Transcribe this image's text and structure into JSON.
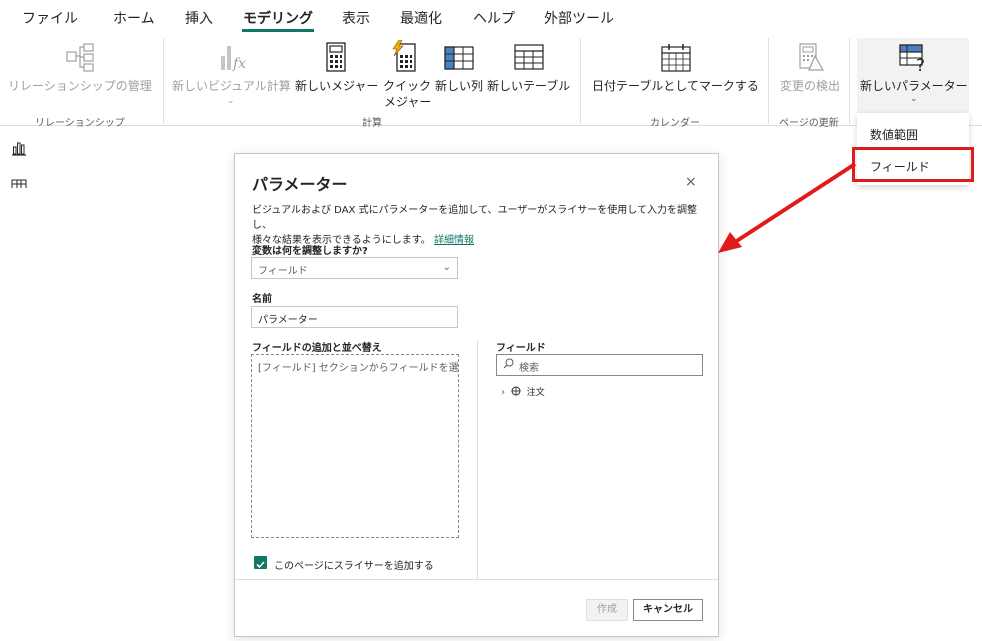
{
  "menu": {
    "items": [
      "ファイル",
      "ホーム",
      "挿入",
      "モデリング",
      "表示",
      "最適化",
      "ヘルプ",
      "外部ツール"
    ],
    "active_index": 3
  },
  "ribbon": {
    "manage_relationships": "リレーションシップの管理",
    "group_relationships": "リレーションシップ",
    "new_visual_calc": "新しいビジュアル計算",
    "new_measure": "新しいメジャー",
    "quick_measure_1": "クイック",
    "quick_measure_2": "メジャー",
    "new_column": "新しい列",
    "new_table": "新しいテーブル",
    "group_calc": "計算",
    "mark_as_date_table": "日付テーブルとしてマークする",
    "group_calendar": "カレンダー",
    "detect_changes": "変更の検出",
    "group_page_refresh": "ページの更新",
    "new_parameter": "新しいパラメーター"
  },
  "dropdown": {
    "numeric_range": "数値範囲",
    "fields": "フィールド"
  },
  "dialog": {
    "title": "パラメーター",
    "close": "×",
    "description_1": "ビジュアルおよび DAX 式にパラメーターを追加して、ユーザーがスライサーを使用して入力を調整し、",
    "description_2": "様々な結果を表示できるようにします。",
    "learn_more": "詳細情報",
    "what_adjust_label": "変数は何を調整しますか?",
    "what_adjust_value": "フィールド",
    "name_label": "名前",
    "name_value": "パラメーター",
    "add_fields_label": "フィールドの追加と並べ替え",
    "dropzone_hint": "[フィールド] セクションからフィールドを選択",
    "fields_label": "フィールド",
    "search_placeholder": "検索",
    "tree_item": "注文",
    "slicer_checkbox_label": "このページにスライサーを追加する",
    "slicer_checked": true,
    "create_button": "作成",
    "cancel_button": "キャンセル"
  },
  "colors": {
    "accent": "#117865",
    "highlight": "#e11b1b",
    "quick_measure_bolt": "#f2b200"
  },
  "icons": {
    "rail_1": "bar-chart-icon",
    "rail_2": "table-icon"
  }
}
